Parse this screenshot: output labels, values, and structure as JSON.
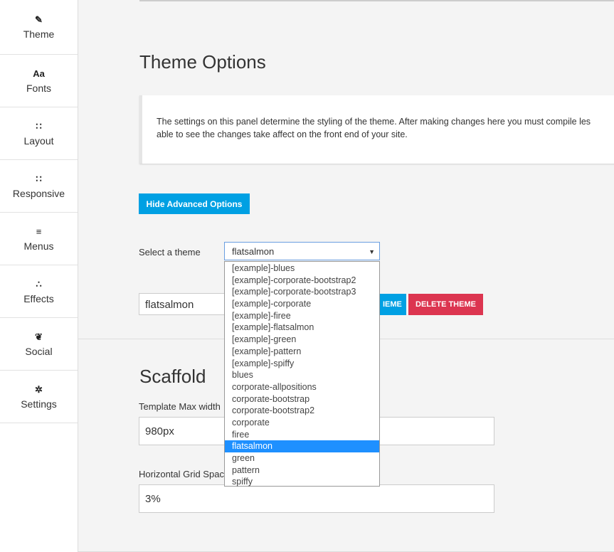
{
  "sidebar": {
    "items": [
      {
        "label": "Theme",
        "icon": "✎"
      },
      {
        "label": "Fonts",
        "icon": "Aa"
      },
      {
        "label": "Layout",
        "icon": "∷"
      },
      {
        "label": "Responsive",
        "icon": "∷"
      },
      {
        "label": "Menus",
        "icon": "≡"
      },
      {
        "label": "Effects",
        "icon": "∴"
      },
      {
        "label": "Social",
        "icon": "❦"
      },
      {
        "label": "Settings",
        "icon": "✲"
      }
    ]
  },
  "main": {
    "title": "Theme Options",
    "info_text_line1": "The settings on this panel determine the styling of the theme. After making changes here you must compile les",
    "info_text_line2": "able to see the changes take affect on the front end of your site.",
    "advanced_button": "Hide Advanced Options",
    "select_label": "Select a theme",
    "selected_theme": "flatsalmon",
    "theme_name_value": "flatsalmon",
    "save_theme_button": "IEME",
    "delete_theme_button": "DELETE THEME",
    "scaffold_title": "Scaffold",
    "max_width_label": "Template Max width",
    "max_width_value": "980px",
    "grid_spacing_label": "Horizontal Grid Spac",
    "grid_spacing_value": "3%"
  },
  "dropdown": {
    "options": [
      "[example]-blues",
      "[example]-corporate-bootstrap2",
      "[example]-corporate-bootstrap3",
      "[example]-corporate",
      "[example]-firee",
      "[example]-flatsalmon",
      "[example]-green",
      "[example]-pattern",
      "[example]-spiffy",
      "blues",
      "corporate-allpositions",
      "corporate-bootstrap",
      "corporate-bootstrap2",
      "corporate",
      "firee",
      "flatsalmon",
      "green",
      "pattern",
      "spiffy"
    ],
    "selected_index": 15
  },
  "colors": {
    "accent_blue": "#00a0e3",
    "danger_red": "#dc3550",
    "highlight": "#1e90ff"
  }
}
